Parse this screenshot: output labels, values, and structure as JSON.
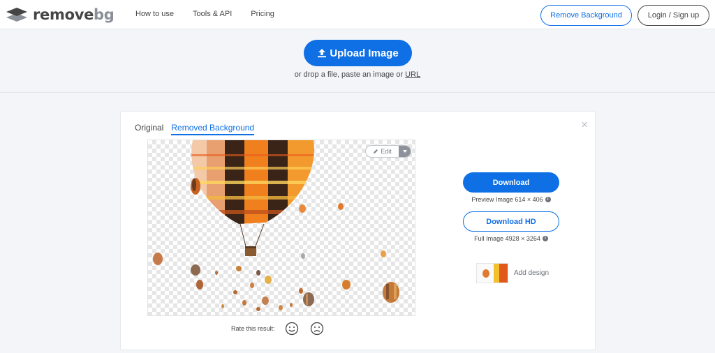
{
  "brand": {
    "name_main": "remove",
    "name_accent": "bg"
  },
  "nav": {
    "links": [
      "How to use",
      "Tools & API",
      "Pricing"
    ]
  },
  "header_buttons": {
    "remove_background": "Remove Background",
    "login": "Login / Sign up"
  },
  "upload": {
    "button_label": "Upload Image",
    "hint_prefix": "or drop a file, paste an image or ",
    "hint_link": "URL"
  },
  "result": {
    "tabs": [
      {
        "label": "Original",
        "active": false
      },
      {
        "label": "Removed Background",
        "active": true
      }
    ],
    "close_icon": "×",
    "edit_label": "Edit",
    "rate_label": "Rate this result:",
    "download_label": "Download",
    "preview_caption": "Preview Image 614 × 406",
    "download_hd_label": "Download HD",
    "full_caption": "Full Image 4928 × 3264",
    "add_design_label": "Add design"
  },
  "colors": {
    "accent": "#0f70e6",
    "text": "#454545",
    "page_bg": "#f4f5f8"
  },
  "icons": [
    "logo-stack-icon",
    "upload-arrow-icon",
    "close-icon",
    "pencil-icon",
    "caret-down-icon",
    "happy-face-icon",
    "sad-face-icon",
    "info-icon"
  ]
}
